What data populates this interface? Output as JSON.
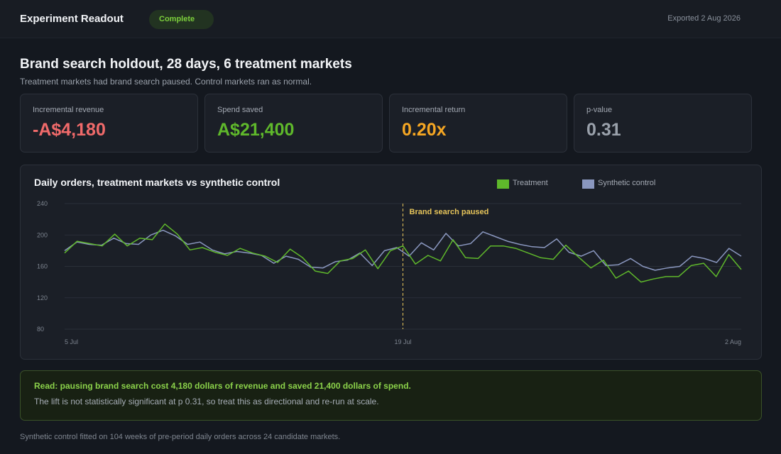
{
  "header": {
    "title": "Experiment Readout",
    "status": "Complete",
    "exported": "Exported 2 Aug 2026"
  },
  "experiment": {
    "title": "Brand search holdout, 28 days, 6 treatment markets",
    "subtitle": "Treatment markets had brand search paused. Control markets ran as normal."
  },
  "kpis": [
    {
      "label": "Incremental revenue",
      "value": "-A$4,180",
      "color": "#f06a6a"
    },
    {
      "label": "Spend saved",
      "value": "A$21,400",
      "color": "#5fb82b"
    },
    {
      "label": "Incremental return",
      "value": "0.20x",
      "color": "#f5a623"
    },
    {
      "label": "p-value",
      "value": "0.31",
      "color": "#9aa1ab"
    }
  ],
  "chart": {
    "title": "Daily orders, treatment markets vs synthetic control",
    "annotation": "Brand search paused",
    "colors": {
      "treatment": "#5fb82b",
      "control": "#8a97bf",
      "annotation": "#e6c45a"
    }
  },
  "chart_data": {
    "type": "line",
    "title": "Daily orders, treatment markets vs synthetic control",
    "xlabel": "",
    "ylabel": "",
    "x_ticks": [
      "5 Jul",
      "19 Jul",
      "2 Aug"
    ],
    "y_ticks": [
      80,
      120,
      160,
      200,
      240
    ],
    "ylim": [
      80,
      240
    ],
    "grid": "horizontal",
    "legend": "top-right",
    "x": [
      "5 Jul",
      "6 Jul",
      "7 Jul",
      "8 Jul",
      "9 Jul",
      "10 Jul",
      "11 Jul",
      "12 Jul",
      "13 Jul",
      "14 Jul",
      "15 Jul",
      "16 Jul",
      "17 Jul",
      "18 Jul",
      "19 Jul",
      "20 Jul",
      "21 Jul",
      "22 Jul",
      "23 Jul",
      "24 Jul",
      "25 Jul",
      "26 Jul",
      "27 Jul",
      "28 Jul",
      "29 Jul",
      "30 Jul",
      "31 Jul",
      "1 Aug",
      "2 Aug"
    ],
    "annotations": [
      {
        "x": "19 Jul",
        "label": "Brand search paused"
      }
    ],
    "series": [
      {
        "name": "Treatment",
        "values": [
          177,
          192,
          189,
          186,
          201,
          186,
          196,
          194,
          214,
          201,
          181,
          184,
          178,
          174,
          183,
          177,
          173,
          165,
          182,
          171,
          154,
          151,
          167,
          170,
          181,
          157,
          180,
          186,
          163,
          174,
          167,
          194,
          171,
          170,
          186,
          186,
          183,
          177,
          171,
          169,
          187,
          172,
          158,
          168,
          145,
          154,
          140,
          144,
          147,
          147,
          161,
          164,
          147,
          175,
          156
        ]
      },
      {
        "name": "Synthetic control",
        "values": [
          180,
          191,
          188,
          187,
          196,
          189,
          188,
          200,
          206,
          199,
          188,
          191,
          181,
          176,
          179,
          177,
          174,
          164,
          173,
          169,
          159,
          158,
          166,
          168,
          177,
          161,
          180,
          184,
          173,
          190,
          181,
          202,
          186,
          189,
          204,
          198,
          192,
          188,
          185,
          184,
          195,
          178,
          173,
          180,
          161,
          162,
          170,
          160,
          155,
          158,
          160,
          173,
          170,
          165,
          183,
          173
        ]
      }
    ]
  },
  "callout": {
    "headline": "Read: pausing brand search cost 4,180 dollars of revenue and saved 21,400 dollars of spend.",
    "body": "The lift is not statistically significant at p 0.31, so treat this as directional and re-run at scale."
  },
  "footnote": "Synthetic control fitted on 104 weeks of pre-period daily orders across 24 candidate markets."
}
